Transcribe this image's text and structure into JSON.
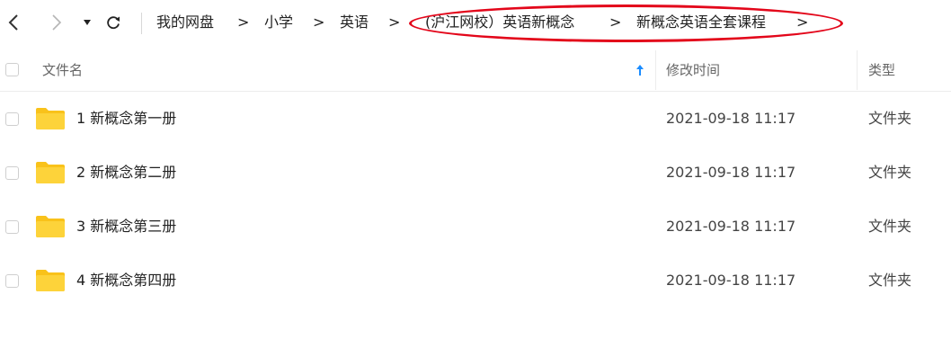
{
  "toolbar": {
    "breadcrumb": [
      "我的网盘",
      "小学",
      "英语",
      "(沪江网校）英语新概念",
      "新概念英语全套课程"
    ],
    "separator": ">"
  },
  "table": {
    "columns": {
      "name": "文件名",
      "modified": "修改时间",
      "type": "类型"
    },
    "rows": [
      {
        "name": "1 新概念第一册",
        "modified": "2021-09-18 11:17",
        "type": "文件夹"
      },
      {
        "name": "2 新概念第二册",
        "modified": "2021-09-18 11:17",
        "type": "文件夹"
      },
      {
        "name": "3 新概念第三册",
        "modified": "2021-09-18 11:17",
        "type": "文件夹"
      },
      {
        "name": "4 新概念第四册",
        "modified": "2021-09-18 11:17",
        "type": "文件夹"
      }
    ]
  },
  "colors": {
    "folder": "#f9c21a",
    "annotation": "#e3061a",
    "sort_arrow": "#1a8cff"
  },
  "icons": [
    "back-icon",
    "forward-icon",
    "dropdown-icon",
    "refresh-icon",
    "sort-up-icon",
    "folder-icon"
  ]
}
